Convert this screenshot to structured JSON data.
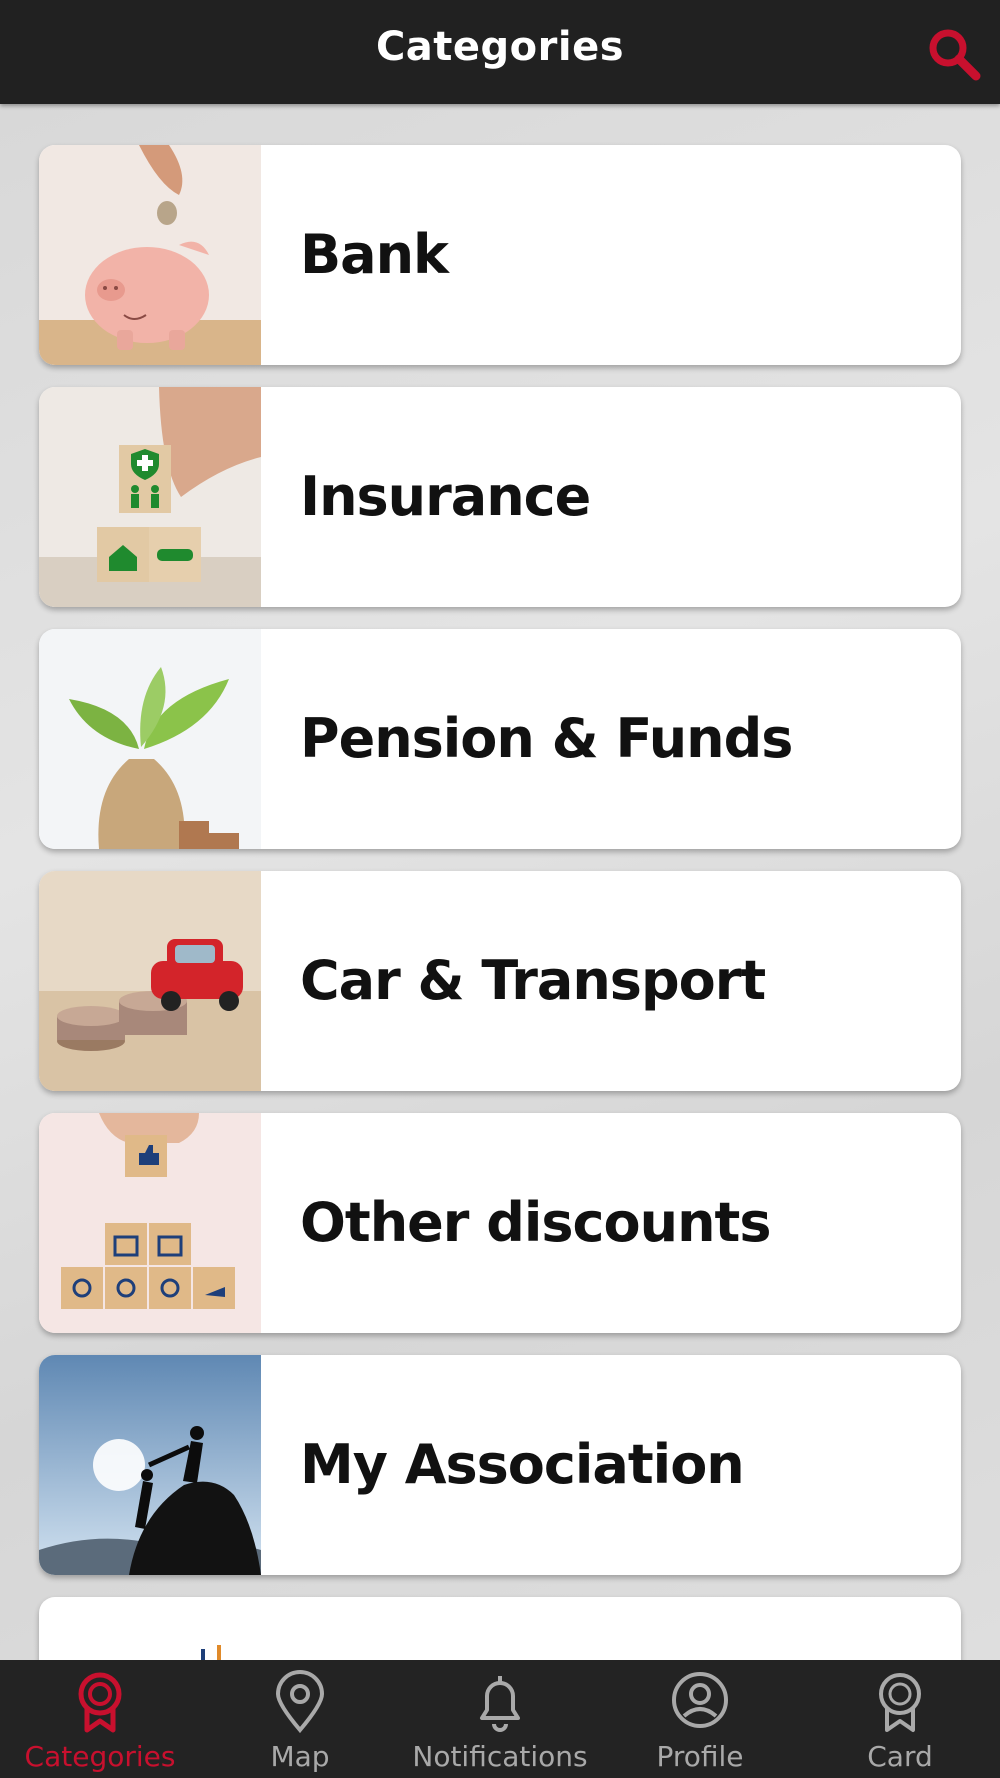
{
  "header": {
    "title": "Categories",
    "search_icon": "search-icon"
  },
  "accent_color": "#c8102e",
  "categories": [
    {
      "label": "Bank",
      "image": "piggy-bank-image"
    },
    {
      "label": "Insurance",
      "image": "insurance-blocks-image"
    },
    {
      "label": "Pension & Funds",
      "image": "plant-money-bag-image"
    },
    {
      "label": "Car & Transport",
      "image": "toy-car-coins-image"
    },
    {
      "label": "Other discounts",
      "image": "discount-blocks-image"
    },
    {
      "label": "My Association",
      "image": "climbers-image"
    }
  ],
  "tabs": [
    {
      "label": "Categories",
      "icon": "ribbon-icon",
      "active": true
    },
    {
      "label": "Map",
      "icon": "map-pin-icon",
      "active": false
    },
    {
      "label": "Notifications",
      "icon": "bell-icon",
      "active": false
    },
    {
      "label": "Profile",
      "icon": "profile-icon",
      "active": false
    },
    {
      "label": "Card",
      "icon": "card-ribbon-icon",
      "active": false
    }
  ]
}
